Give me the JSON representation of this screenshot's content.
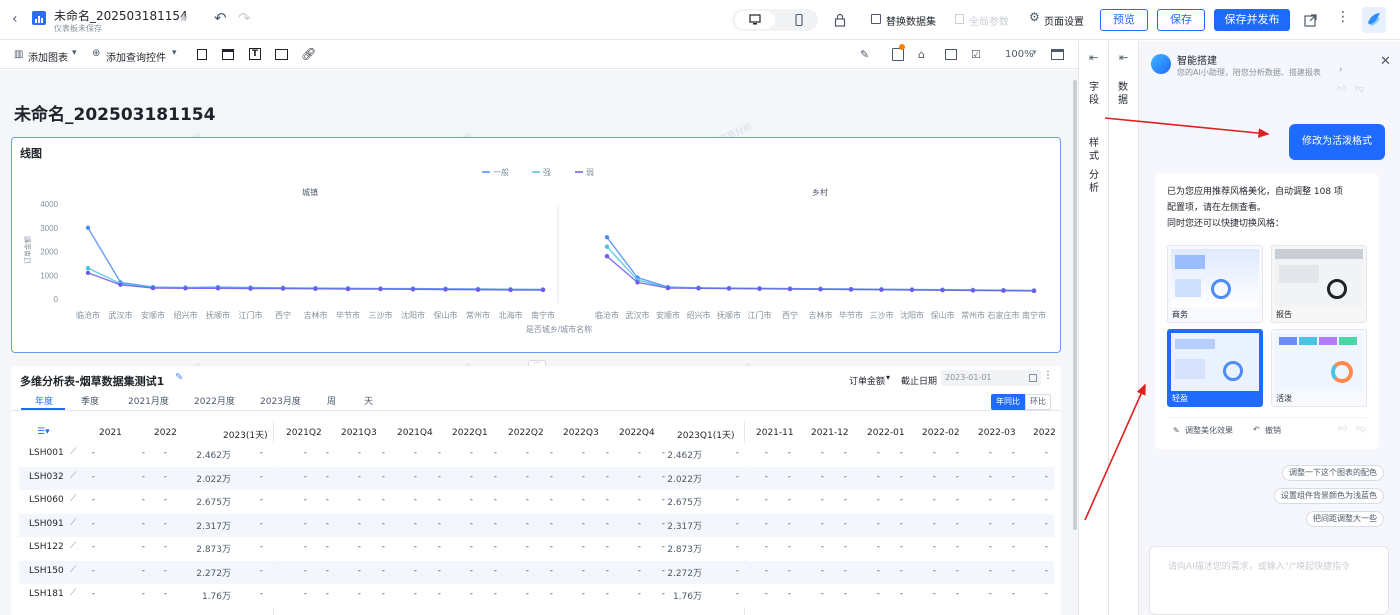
{
  "header": {
    "title": "未命名_202503181154",
    "subtitle": "仪表板未保存",
    "replace_dataset": "替换数据集",
    "global_params": "全局参数",
    "page_settings": "页面设置",
    "preview": "预览",
    "save": "保存",
    "save_publish": "保存并发布"
  },
  "toolbar": {
    "add_chart": "添加图表",
    "add_query": "添加查询控件",
    "zoom": "100%"
  },
  "dashboard": {
    "title": "未命名_202503181154"
  },
  "line_chart": {
    "title": "线图",
    "legend": [
      "一般",
      "强",
      "弱"
    ],
    "xlabel": "是否城乡/城市名称",
    "ylabel": "订单金额",
    "yticks": [
      "4000",
      "3000",
      "2000",
      "1000",
      "0"
    ]
  },
  "chart_data": {
    "type": "line",
    "title": "线图",
    "facets": [
      "城镇",
      "乡村"
    ],
    "categories": [
      "临沧市",
      "武汉市",
      "安顺市",
      "绍兴市",
      "抚顺市",
      "江门市",
      "西宁",
      "吉林市",
      "毕节市",
      "三沙市",
      "沈阳市",
      "保山市",
      "常州市",
      "北海市",
      "南宁市"
    ],
    "categories_rural": [
      "临沧市",
      "武汉市",
      "安顺市",
      "绍兴市",
      "抚顺市",
      "江门市",
      "西宁",
      "吉林市",
      "毕节市",
      "三沙市",
      "沈阳市",
      "保山市",
      "常州市",
      "石家庄市",
      "南宁市"
    ],
    "xlabel": "是否城乡/城市名称",
    "ylabel": "订单金额",
    "ylim": [
      0,
      4000
    ],
    "series": [
      {
        "name": "一般",
        "color": "#4e8cf7",
        "urban": [
          3000,
          700,
          500,
          480,
          500,
          480,
          470,
          460,
          450,
          440,
          440,
          430,
          420,
          410,
          400
        ],
        "rural": [
          2600,
          900,
          500,
          470,
          460,
          450,
          440,
          430,
          420,
          410,
          400,
          390,
          380,
          370,
          360
        ]
      },
      {
        "name": "强",
        "color": "#4bc3e3",
        "urban": [
          1300,
          650,
          480,
          470,
          470,
          460,
          450,
          450,
          440,
          430,
          420,
          410,
          400,
          400,
          390
        ],
        "rural": [
          2200,
          800,
          480,
          460,
          450,
          440,
          430,
          420,
          410,
          400,
          390,
          380,
          370,
          360,
          350
        ]
      },
      {
        "name": "弱",
        "color": "#6c5ce7",
        "urban": [
          1100,
          600,
          460,
          450,
          450,
          440,
          440,
          430,
          420,
          420,
          410,
          400,
          390,
          380,
          380
        ],
        "rural": [
          1800,
          700,
          460,
          450,
          440,
          430,
          420,
          410,
          400,
          390,
          380,
          370,
          360,
          350,
          340
        ]
      }
    ]
  },
  "pivot": {
    "title": "多维分析表-烟草数据集测试1",
    "measure": "订单金额",
    "cutoff_label": "截止日期",
    "cutoff_value": "2023-01-01",
    "tabs": [
      "年度",
      "季度",
      "2021月度",
      "2022月度",
      "2023月度",
      "周",
      "天"
    ],
    "yoy": "年同比",
    "mom": "环比",
    "columns": [
      "2021",
      "2022",
      "2023(1天)",
      "2021Q2",
      "2021Q3",
      "2021Q4",
      "2022Q1",
      "2022Q2",
      "2022Q3",
      "2022Q4",
      "2023Q1(1天)",
      "2021-11",
      "2021-12",
      "2022-01",
      "2022-02",
      "2022-03",
      "2022"
    ],
    "rows": [
      {
        "id": "LSH001",
        "v2023": "2.462万",
        "vq1": "2.462万"
      },
      {
        "id": "LSH032",
        "v2023": "2.022万",
        "vq1": "2.022万"
      },
      {
        "id": "LSH060",
        "v2023": "2.675万",
        "vq1": "2.675万"
      },
      {
        "id": "LSH091",
        "v2023": "2.317万",
        "vq1": "2.317万"
      },
      {
        "id": "LSH122",
        "v2023": "2.873万",
        "vq1": "2.873万"
      },
      {
        "id": "LSH150",
        "v2023": "2.272万",
        "vq1": "2.272万"
      },
      {
        "id": "LSH181",
        "v2023": "1.76万",
        "vq1": "1.76万"
      }
    ],
    "dash": "-"
  },
  "side_tabs": {
    "fields": "字段",
    "style": "样式",
    "analysis": "分析",
    "data": "数据"
  },
  "assistant": {
    "title": "智能搭建",
    "subtitle": "您的AI小助理，陪您分析数据、搭建报表",
    "user_msg": "修改为活泼格式",
    "reply_line1": "已为您应用推荐风格美化，自动调整 108 项",
    "reply_line2": "配置项，请在左侧查看。",
    "reply_line3": "同时您还可以快捷切换风格：",
    "styles": [
      "商务",
      "报告",
      "轻盈",
      "活泼"
    ],
    "adjust": "调整美化效果",
    "undo": "撤销",
    "suggestions": [
      "调整一下这个图表的配色",
      "设置组件背景颜色为浅蓝色",
      "把间距调整大一些"
    ],
    "input_placeholder": "请向AI描述您的需求，或输入\"/\"唤起快捷指令"
  },
  "watermark": "小明烟草分析",
  "colors": {
    "primary": "#1f6bff",
    "arrow": "#e02020",
    "accent": "#4e8cf7"
  }
}
